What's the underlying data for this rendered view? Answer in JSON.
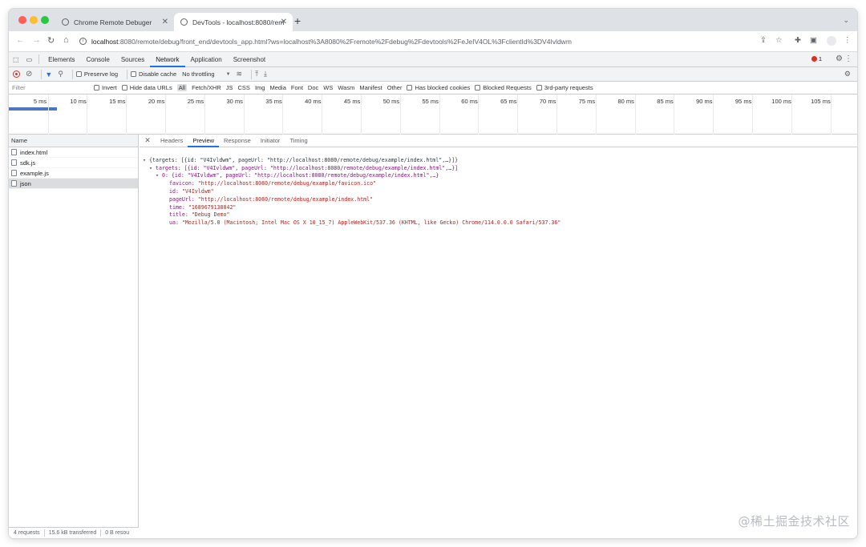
{
  "browser": {
    "tabs": [
      {
        "title": "Chrome Remote Debuger",
        "close": "✕"
      },
      {
        "title": "DevTools - localhost:8080/rem",
        "close": "✕"
      }
    ],
    "new_tab": "+",
    "tab_menu": "⌄",
    "url_host": "localhost",
    "url_rest": ":8080/remote/debug/front_end/devtools_app.html?ws=localhost%3A8080%2Fremote%2Fdebug%2Fdevtools%2FeJeIV4OL%3FclientId%3DV4Ivldwm",
    "info_icon": "i",
    "back": "←",
    "forward": "→",
    "reload": "↻",
    "home": "⌂",
    "menu": "⋮"
  },
  "devtools": {
    "tabs": [
      "Elements",
      "Console",
      "Sources",
      "Network",
      "Application",
      "Screenshot"
    ],
    "active_tab": "Network",
    "issues_count": "1",
    "settings": "⚙",
    "more": "⋮",
    "netbar": {
      "preserve_log": "Preserve log",
      "disable_cache": "Disable cache",
      "throttling": "No throttling",
      "throttling_caret": "▼"
    },
    "filter": {
      "placeholder": "Filter",
      "invert": "Invert",
      "hide_data_urls": "Hide data URLs",
      "types": [
        "All",
        "Fetch/XHR",
        "JS",
        "CSS",
        "Img",
        "Media",
        "Font",
        "Doc",
        "WS",
        "Wasm",
        "Manifest",
        "Other"
      ],
      "has_blocked_cookies": "Has blocked cookies",
      "blocked_requests": "Blocked Requests",
      "third_party": "3rd-party requests"
    },
    "timeline_ticks": [
      "5 ms",
      "10 ms",
      "15 ms",
      "20 ms",
      "25 ms",
      "30 ms",
      "35 ms",
      "40 ms",
      "45 ms",
      "50 ms",
      "55 ms",
      "60 ms",
      "65 ms",
      "70 ms",
      "75 ms",
      "80 ms",
      "85 ms",
      "90 ms",
      "95 ms",
      "100 ms",
      "105 ms",
      "11"
    ],
    "requests": {
      "header": "Name",
      "items": [
        "index.html",
        "sdk.js",
        "example.js",
        "json"
      ],
      "selected": "json"
    },
    "status": {
      "requests": "4 requests",
      "transferred": "15.6 kB transferred",
      "resources": "0 B resou"
    },
    "detail_tabs": [
      "Headers",
      "Preview",
      "Response",
      "Initiator",
      "Timing"
    ],
    "detail_active": "Preview",
    "detail_close": "✕",
    "preview": {
      "line1": "{targets: [{id: \"V4Ivldwm\", pageUrl: \"http://localhost:8080/remote/debug/example/index.html\",…}]}",
      "line2": "targets: [{id: \"V4Ivldwm\", pageUrl: \"http://localhost:8080/remote/debug/example/index.html\",…}]",
      "line3": "0: {id: \"V4Ivldwm\", pageUrl: \"http://localhost:8080/remote/debug/example/index.html\",…}",
      "favicon_key": "favicon:",
      "favicon_val": "\"http://localhost:8080/remote/debug/example/favicon.ico\"",
      "id_key": "id:",
      "id_val": "\"V4Ivldwm\"",
      "pageurl_key": "pageUrl:",
      "pageurl_val": "\"http://localhost:8080/remote/debug/example/index.html\"",
      "time_key": "time:",
      "time_val": "\"1689679138842\"",
      "title_key": "title:",
      "title_val": "\"Debug Demo\"",
      "ua_key": "ua:",
      "ua_val": "\"Mozilla/5.0 (Macintosh; Intel Mac OS X 10_15_7) AppleWebKit/537.36 (KHTML, like Gecko) Chrome/114.0.0.0 Safari/537.36\""
    }
  },
  "watermark": "@稀土掘金技术社区",
  "colors": {
    "accent": "#1a73e8",
    "close_red": "#ff5f57",
    "minimize_yellow": "#febc2e",
    "zoom_green": "#28c840",
    "record_red": "#d93025"
  }
}
